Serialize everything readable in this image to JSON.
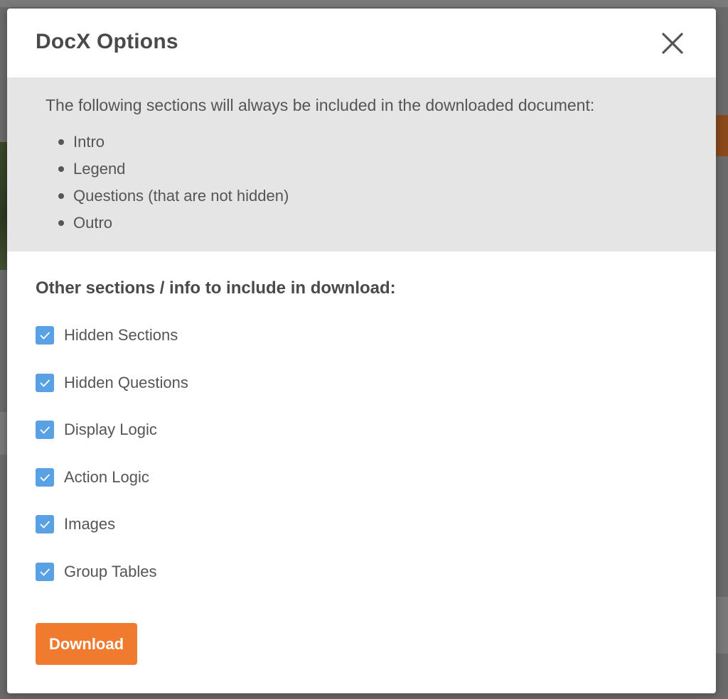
{
  "modal": {
    "title": "DocX Options",
    "close_icon": "close-icon",
    "info": {
      "text": "The following sections will always be included in the downloaded document:",
      "items": [
        "Intro",
        "Legend",
        "Questions (that are not hidden)",
        "Outro"
      ]
    },
    "heading": "Other sections / info to include in download:",
    "options": [
      {
        "label": "Hidden Sections",
        "checked": true
      },
      {
        "label": "Hidden Questions",
        "checked": true
      },
      {
        "label": "Display Logic",
        "checked": true
      },
      {
        "label": "Action Logic",
        "checked": true
      },
      {
        "label": "Images",
        "checked": true
      },
      {
        "label": "Group Tables",
        "checked": true
      }
    ],
    "download_label": "Download"
  },
  "colors": {
    "accent": "#f07a2e",
    "checkbox": "#5aa1e3",
    "info_bg": "#e5e5e5",
    "text": "#555555",
    "overlay": "#6b6b6b"
  }
}
